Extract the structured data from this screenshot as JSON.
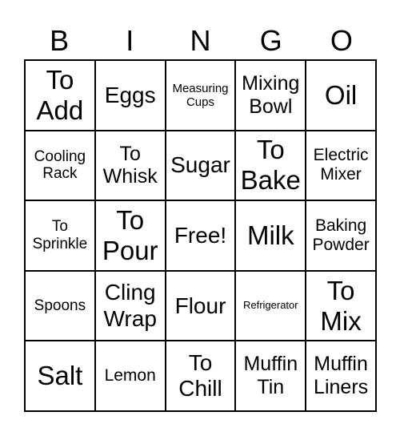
{
  "header": [
    "B",
    "I",
    "N",
    "G",
    "O"
  ],
  "cells": [
    [
      "To Add",
      "Eggs",
      "Measuring Cups",
      "Mixing Bowl",
      "Oil"
    ],
    [
      "Cooling Rack",
      "To Whisk",
      "Sugar",
      "To Bake",
      "Electric Mixer"
    ],
    [
      "To Sprinkle",
      "To Pour",
      "Free!",
      "Milk",
      "Baking Powder"
    ],
    [
      "Spoons",
      "Cling Wrap",
      "Flour",
      "Refrigerator",
      "To Mix"
    ],
    [
      "Salt",
      "Lemon",
      "To Chill",
      "Muffin Tin",
      "Muffin Liners"
    ]
  ]
}
